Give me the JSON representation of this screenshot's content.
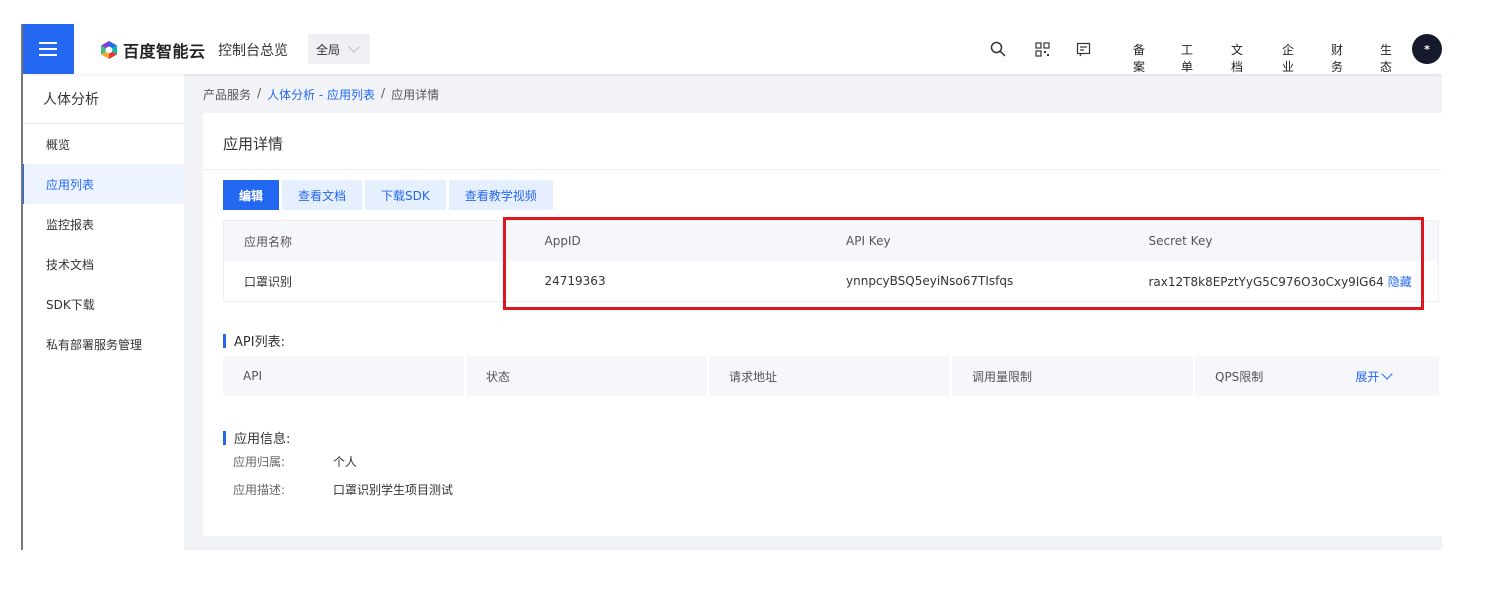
{
  "topbar": {
    "brand": "百度智能云",
    "console_title": "控制台总览",
    "region": "全局",
    "links": [
      "备案",
      "工单",
      "文档",
      "企业",
      "财务",
      "生态"
    ],
    "avatar_text": "*",
    "accent": "#2468f2"
  },
  "sidebar": {
    "title": "人体分析",
    "items": [
      {
        "label": "概览"
      },
      {
        "label": "应用列表"
      },
      {
        "label": "监控报表"
      },
      {
        "label": "技术文档"
      },
      {
        "label": "SDK下载"
      },
      {
        "label": "私有部署服务管理"
      }
    ]
  },
  "breadcrumb": {
    "root": "产品服务",
    "parent": "人体分析 - 应用列表",
    "current": "应用详情",
    "separator": "/"
  },
  "main": {
    "title": "应用详情",
    "buttons": [
      "编辑",
      "查看文档",
      "下载SDK",
      "查看教学视频"
    ],
    "credentials": {
      "headers": [
        "应用名称",
        "AppID",
        "API Key",
        "Secret Key"
      ],
      "row": {
        "name": "口罩识别",
        "app_id": "24719363",
        "api_key": "ynnpcyBSQ5eyiNso67TIsfqs",
        "secret_key": "rax12T8k8EPztYyG5C976O3oCxy9lG64",
        "hide_label": "隐藏"
      }
    },
    "api_section": {
      "title": "API列表:",
      "headers": [
        "API",
        "状态",
        "请求地址",
        "调用量限制",
        "QPS限制"
      ],
      "expand_label": "展开"
    },
    "info_section": {
      "title": "应用信息:",
      "rows": [
        {
          "key": "应用归属:",
          "value": "个人"
        },
        {
          "key": "应用描述:",
          "value": "口罩识别学生项目测试"
        }
      ]
    },
    "highlight_color": "#e0161e"
  }
}
